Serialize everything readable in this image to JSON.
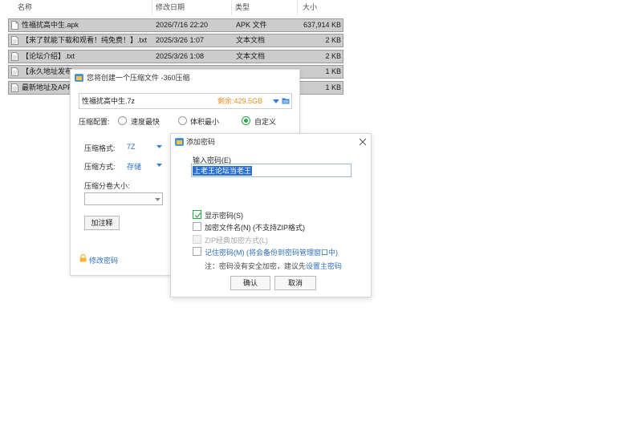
{
  "explorer": {
    "headers": {
      "name": "名称",
      "date": "修改日期",
      "type": "类型",
      "size": "大小"
    },
    "rows": [
      {
        "name": "性福扰高中生.apk",
        "date": "2026/7/16 22:20",
        "type": "APK 文件",
        "size": "637,914 KB",
        "icon": "apk-file-icon"
      },
      {
        "name": "【来了就能下载和观看！纯免费！】.txt",
        "date": "2025/3/26 1:07",
        "type": "文本文档",
        "size": "2 KB",
        "icon": "text-file-icon"
      },
      {
        "name": "【论坛介绍】.txt",
        "date": "2025/3/26 1:08",
        "type": "文本文档",
        "size": "2 KB",
        "icon": "text-file-icon"
      },
      {
        "name": "【永久地址发布",
        "date": "",
        "type": "",
        "size": "1 KB",
        "icon": "text-file-icon"
      },
      {
        "name": "最新地址及APP",
        "date": "",
        "type": "",
        "size": "1 KB",
        "icon": "text-file-icon"
      }
    ]
  },
  "zip_dialog": {
    "title": "您将创建一个压缩文件 -360压缩",
    "filename": "性福扰高中生.7z",
    "free_space": "剩余:429.5GB",
    "config_label": "压缩配置:",
    "radio_fast": "速度最快",
    "radio_small": "体积最小",
    "radio_custom": "自定义",
    "selected_config": "自定义",
    "format_label": "压缩格式:",
    "format_value": "7Z",
    "method_label": "压缩方式:",
    "method_value": "存储",
    "split_label": "压缩分卷大小:",
    "split_value": "",
    "comment_button": "加注释",
    "change_password_link": "修改密码"
  },
  "password_dialog": {
    "title": "添加密码",
    "input_label": "输入密码(E)",
    "password_value": "上老王论坛当老王",
    "show_password_label": "显示密码(S)",
    "show_password_checked": true,
    "encrypt_names_label": "加密文件名(N) (不支持ZIP格式)",
    "encrypt_names_checked": false,
    "zip_classic_label": "ZIP经典加密方式(L)",
    "remember_label": "记住密码(M) (将会备份到密码管理窗口中)",
    "note_prefix": "注：密码没有安全加密，建议先",
    "note_link": "设置主密码",
    "ok_button": "确认",
    "cancel_button": "取消"
  },
  "colors": {
    "accent_blue": "#2f6fb8",
    "check_green": "#2aa84a",
    "free_space_orange": "#f28b1d",
    "selection_blue": "#2a6fd2",
    "row_selected_gray": "#cccccc"
  }
}
